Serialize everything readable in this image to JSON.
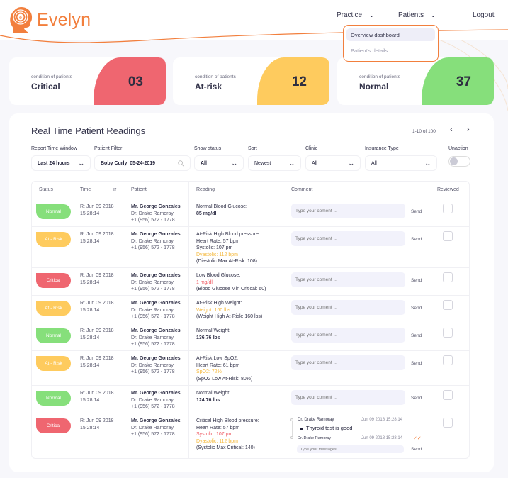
{
  "brand": {
    "name": "Evelyn",
    "color": "#f27f3d"
  },
  "nav": {
    "practice": "Practice",
    "patients": "Patients",
    "logout": "Logout",
    "patients_menu": [
      "Overview dashboard",
      "Patient's details"
    ]
  },
  "summary": [
    {
      "sub": "condition of patients",
      "title": "Critical",
      "count": "03",
      "color": "#ef6670"
    },
    {
      "sub": "condition of patients",
      "title": "At-risk",
      "count": "12",
      "color": "#fecb5e"
    },
    {
      "sub": "condition of patients",
      "title": "Normal",
      "count": "37",
      "color": "#86df7b"
    }
  ],
  "panel": {
    "title": "Real Time Patient Readings",
    "pagination": "1-10 of 100",
    "filters": {
      "report_time_window": {
        "label": "Report Time Window",
        "value": "Last 24 hours"
      },
      "patient_filter": {
        "label": "Patient Filter",
        "value": "Boby Curly  05-24-2019"
      },
      "show_status": {
        "label": "Show status",
        "value": "All"
      },
      "sort": {
        "label": "Sort",
        "value": "Newest"
      },
      "clinic": {
        "label": "Clinic",
        "value": "All"
      },
      "insurance_type": {
        "label": "Insurance Type",
        "value": "All"
      },
      "unaction": {
        "label": "Unaction",
        "on": false
      }
    },
    "columns": [
      "Status",
      "Time",
      "Patient",
      "Reading",
      "Comment",
      "Reviewed"
    ],
    "comment_placeholder": "Type your coment ...",
    "send_label": "Send",
    "rows": [
      {
        "status": "Normal",
        "time1": "R: Jun 09 2018",
        "time2": "15:28:14",
        "patient": "Mr. George Gonzales",
        "doctor": "Dr. Drake Ramoray",
        "phone": "+1 (956) 572 - 1778",
        "reading": [
          {
            "t": "Normal Blood Glucose:",
            "s": "plain"
          },
          {
            "t": "85 mg/dl",
            "s": "bold"
          }
        ]
      },
      {
        "status": "At - Risk",
        "time1": "R: Jun 09 2018",
        "time2": "15:28:14",
        "patient": "Mr. George Gonzales",
        "doctor": "Dr. Drake Ramoray",
        "phone": "+1 (956) 572 - 1778",
        "reading": [
          {
            "t": "At-Risk High Blood pressure:",
            "s": "plain"
          },
          {
            "t": "Heart Rate: 57 bpm",
            "s": "plain"
          },
          {
            "t": "Systolic: 107 pm",
            "s": "plain"
          },
          {
            "t": "Dyastolic: 112 bpm",
            "s": "warn"
          },
          {
            "t": "(Diastolic Max At-Risk: 108)",
            "s": "plain"
          }
        ]
      },
      {
        "status": "Critical",
        "time1": "R: Jun 09 2018",
        "time2": "15:28:14",
        "patient": "Mr. George Gonzales",
        "doctor": "Dr. Drake Ramoray",
        "phone": "+1 (956) 572 - 1778",
        "reading": [
          {
            "t": "Low Blood Glucose:",
            "s": "plain"
          },
          {
            "t": "1 mg/dl",
            "s": "crit"
          },
          {
            "t": "(Blood Glucose Min Critical: 60)",
            "s": "plain"
          }
        ]
      },
      {
        "status": "At - Risk",
        "time1": "R: Jun 09 2018",
        "time2": "15:28:14",
        "patient": "Mr. George Gonzales",
        "doctor": "Dr. Drake Ramoray",
        "phone": "+1 (956) 572 - 1778",
        "reading": [
          {
            "t": "At-Risk High Weight:",
            "s": "plain"
          },
          {
            "t": "Weight: 160 lbs",
            "s": "warn"
          },
          {
            "t": "(Weight High At-Risk: 160 lbs)",
            "s": "plain"
          }
        ]
      },
      {
        "status": "Normal",
        "time1": "R: Jun 09 2018",
        "time2": "15:28:14",
        "patient": "Mr. George Gonzales",
        "doctor": "Dr. Drake Ramoray",
        "phone": "+1 (956) 572 - 1778",
        "reading": [
          {
            "t": "Normal Weight:",
            "s": "plain"
          },
          {
            "t": "136.76 lbs",
            "s": "bold"
          }
        ]
      },
      {
        "status": "At - Risk",
        "time1": "R: Jun 09 2018",
        "time2": "15:28:14",
        "patient": "Mr. George Gonzales",
        "doctor": "Dr. Drake Ramoray",
        "phone": "+1 (956) 572 - 1778",
        "reading": [
          {
            "t": "At-Risk Low SpO2:",
            "s": "plain"
          },
          {
            "t": "Heart Rate: 61 bpm",
            "s": "plain"
          },
          {
            "t": "SpO2: 72%",
            "s": "warn"
          },
          {
            "t": "(SpO2 Low At-Risk: 80%)",
            "s": "plain"
          }
        ]
      },
      {
        "status": "Normal",
        "time1": "R: Jun 09 2018",
        "time2": "15:28:14",
        "patient": "Mr. George Gonzales",
        "doctor": "Dr. Drake Ramoray",
        "phone": "+1 (956) 572 - 1778",
        "reading": [
          {
            "t": "Normal Weight:",
            "s": "plain"
          },
          {
            "t": "124.76 lbs",
            "s": "bold"
          }
        ]
      },
      {
        "status": "Critical",
        "time1": "R: Jun 09 2018",
        "time2": "15:28:14",
        "patient": "Mr. George Gonzales",
        "doctor": "Dr. Drake Ramoray",
        "phone": "+1 (956) 572 - 1778",
        "reading": [
          {
            "t": "Critical High Blood pressure:",
            "s": "plain"
          },
          {
            "t": "Heart Rate: 57 bpm",
            "s": "plain"
          },
          {
            "t": "Systolic: 107 pm",
            "s": "crit"
          },
          {
            "t": "Dyastolic: 112 bpm",
            "s": "warn"
          },
          {
            "t": "(Systolic Max Critical: 140)",
            "s": "plain"
          }
        ],
        "thread": {
          "messages": [
            {
              "author": "Dr. Drake Ramoray",
              "time": "Jun 09 2018 15:28:14",
              "text": "Thyroid test is good"
            },
            {
              "author": "Dr. Drake Ramoray",
              "time": "Jun 09 2018 15:28:14",
              "text": ""
            }
          ],
          "placeholder": "Type your messages ..."
        }
      }
    ]
  },
  "colors": {
    "normal": "#86df7b",
    "atrisk": "#fecb5e",
    "critical": "#ef6670",
    "warn_text": "#f5b93d",
    "crit_text": "#ef5a63"
  }
}
